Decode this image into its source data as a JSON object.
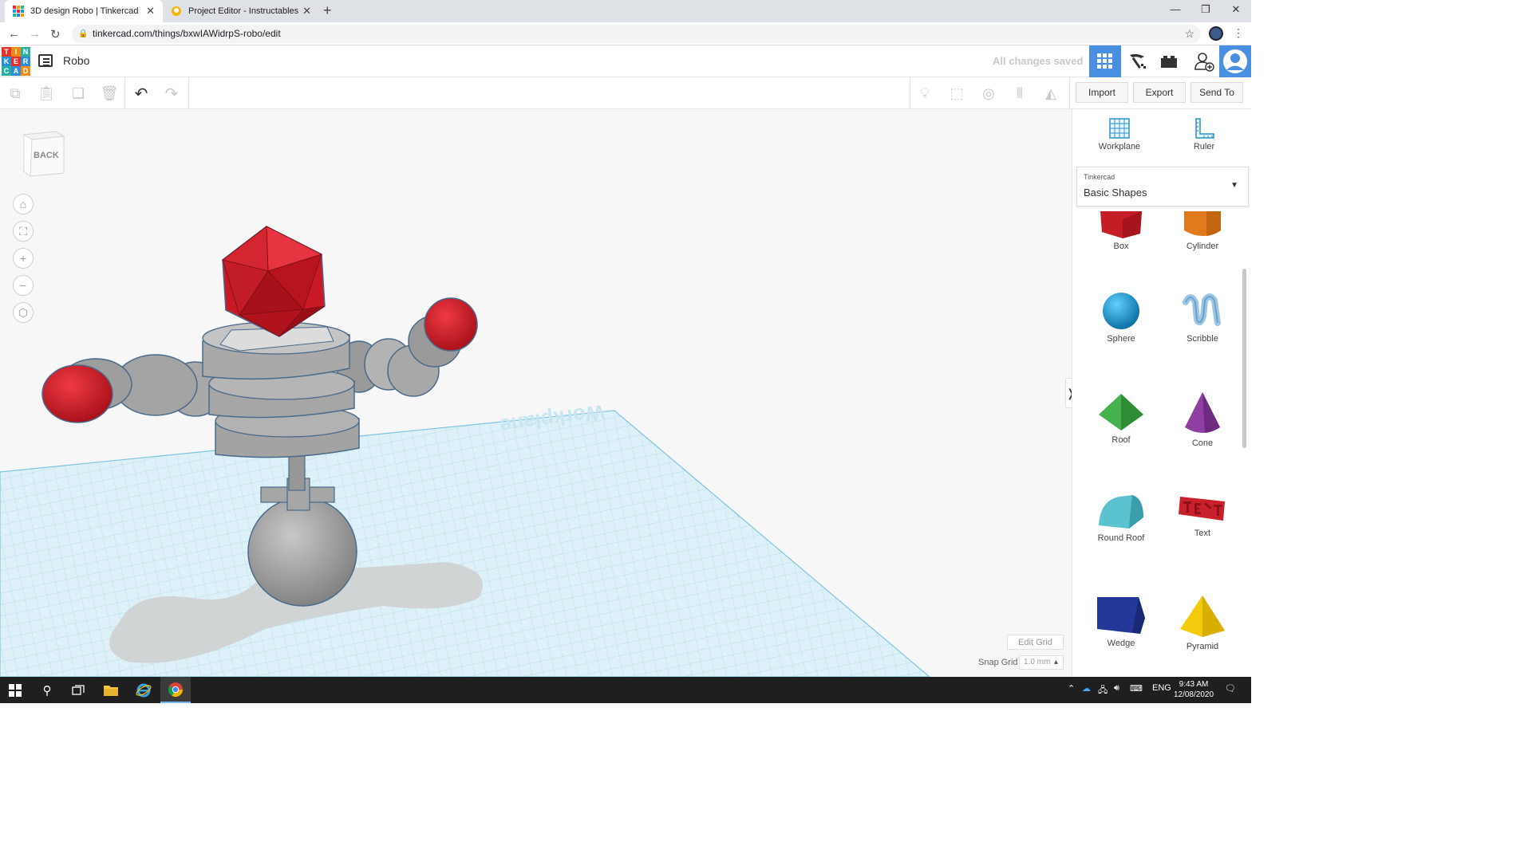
{
  "browser": {
    "tabs": [
      {
        "title": "3D design Robo | Tinkercad",
        "active": true
      },
      {
        "title": "Project Editor - Instructables",
        "active": false
      }
    ],
    "url": "tinkercad.com/things/bxwIAWidrpS-robo/edit"
  },
  "header": {
    "logo_letters": [
      "T",
      "I",
      "N",
      "K",
      "E",
      "R",
      "C",
      "A",
      "D"
    ],
    "doc_title": "Robo",
    "save_status": "All changes saved",
    "views": [
      "3d-design-grid-icon",
      "pickaxe-icon",
      "brick-icon"
    ],
    "accent": "#4a90e2"
  },
  "toolbar": {
    "actions": {
      "import": "Import",
      "export": "Export",
      "send_to": "Send To"
    }
  },
  "viewport": {
    "viewcube_label": "BACK",
    "workplane_label": "Workplane",
    "edit_grid": "Edit Grid",
    "snap_grid_label": "Snap Grid",
    "snap_grid_value": "1.0 mm"
  },
  "panel": {
    "tools": [
      {
        "label": "Workplane",
        "icon": "workplane-icon"
      },
      {
        "label": "Ruler",
        "icon": "ruler-icon"
      }
    ],
    "library_source": "Tinkercad",
    "library_name": "Basic Shapes",
    "shapes": [
      {
        "label": "Box",
        "color": "#d0232b"
      },
      {
        "label": "Cylinder",
        "color": "#e0771e"
      },
      {
        "label": "Sphere",
        "color": "#1b9bd4"
      },
      {
        "label": "Scribble",
        "color": "#9cc6e6"
      },
      {
        "label": "Roof",
        "color": "#3fae49"
      },
      {
        "label": "Cone",
        "color": "#8e3fa1"
      },
      {
        "label": "Round Roof",
        "color": "#5bc2cf"
      },
      {
        "label": "Text",
        "color": "#c9202c"
      },
      {
        "label": "Wedge",
        "color": "#24389a"
      },
      {
        "label": "Pyramid",
        "color": "#f2cc0c"
      }
    ]
  },
  "taskbar": {
    "language": "ENG",
    "time": "9:43 AM",
    "date": "12/08/2020"
  }
}
